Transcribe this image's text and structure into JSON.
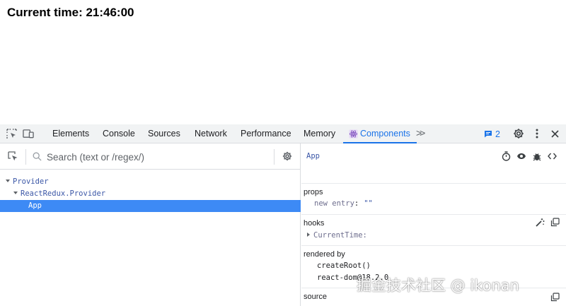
{
  "app": {
    "heading": "Current time: 21:46:00"
  },
  "devtools": {
    "tabs": [
      {
        "label": "Elements"
      },
      {
        "label": "Console"
      },
      {
        "label": "Sources"
      },
      {
        "label": "Network"
      },
      {
        "label": "Performance"
      },
      {
        "label": "Memory"
      },
      {
        "label": "Components",
        "active": true
      }
    ],
    "issues_count": "2",
    "accent_color": "#1a73e8",
    "icons": [
      "inspect-element-icon",
      "device-toolbar-icon",
      "more-tabs-icon",
      "issues-icon",
      "settings-icon",
      "more-options-icon",
      "close-icon"
    ]
  },
  "components": {
    "search": {
      "placeholder": "Search (text or /regex/)",
      "value": ""
    },
    "tree": [
      {
        "label": "Provider",
        "expanded": true,
        "depth": 0
      },
      {
        "label": "ReactRedux.Provider",
        "expanded": true,
        "depth": 1
      },
      {
        "label": "App",
        "selected": true,
        "depth": 2
      }
    ],
    "selected_color": "#3d8af5",
    "inspector": {
      "name": "App",
      "header_icons": [
        "stopwatch-icon",
        "eye-icon",
        "bug-icon",
        "view-source-icon"
      ],
      "props": {
        "title": "props",
        "key": "new entry",
        "colon": ":",
        "value": "\"\""
      },
      "hooks": {
        "title": "hooks",
        "item": "CurrentTime:",
        "icons": [
          "magic-wand-icon",
          "copy-icon"
        ]
      },
      "rendered_by": {
        "title": "rendered by",
        "items": [
          "createRoot()",
          "react-dom@18.2.0"
        ]
      },
      "source": {
        "title": "source"
      }
    }
  },
  "watermark": "掘金技术社区 @ ikonan"
}
